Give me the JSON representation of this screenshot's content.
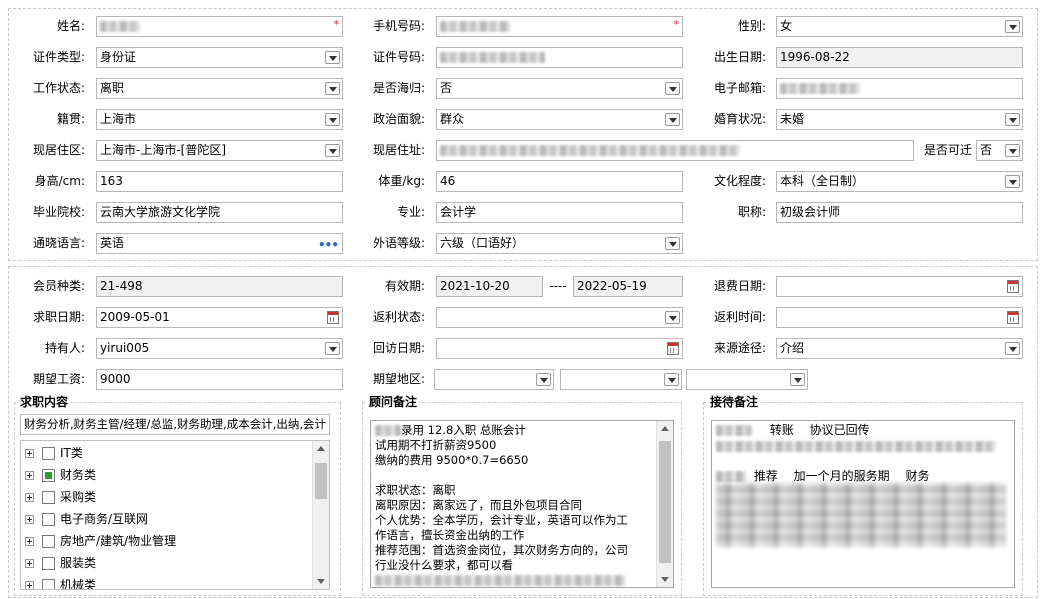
{
  "personal": {
    "name_label": "姓名:",
    "mobile_label": "手机号码:",
    "gender_label": "性别:",
    "gender_value": "女",
    "id_type_label": "证件类型:",
    "id_type_value": "身份证",
    "id_no_label": "证件号码:",
    "birth_label": "出生日期:",
    "birth_value": "1996-08-22",
    "work_status_label": "工作状态:",
    "work_status_value": "离职",
    "returnee_label": "是否海归:",
    "returnee_value": "否",
    "email_label": "电子邮箱:",
    "native_label": "籍贯:",
    "native_value": "上海市",
    "political_label": "政治面貌:",
    "political_value": "群众",
    "marital_label": "婚育状况:",
    "marital_value": "未婚",
    "district_label": "现居住区:",
    "district_value": "上海市-上海市-[普陀区]",
    "address_label": "现居住址:",
    "relocate_label": "是否可迁",
    "relocate_value": "否",
    "height_label": "身高/cm:",
    "height_value": "163",
    "weight_label": "体重/kg:",
    "weight_value": "46",
    "education_label": "文化程度:",
    "education_value": "本科（全日制）",
    "school_label": "毕业院校:",
    "school_value": "云南大学旅游文化学院",
    "major_label": "专业:",
    "major_value": "会计学",
    "title_label": "职称:",
    "title_value": "初级会计师",
    "lang_label": "通晓语言:",
    "lang_value": "英语",
    "lang_more": "•••",
    "lang_level_label": "外语等级:",
    "lang_level_value": "六级（口语好）",
    "required_mark": "*"
  },
  "member": {
    "type_label": "会员种类:",
    "type_value": "21-498",
    "valid_label": "有效期:",
    "valid_from": "2021-10-20",
    "valid_sep": "----",
    "valid_to": "2022-05-19",
    "refund_date_label": "退费日期:",
    "job_date_label": "求职日期:",
    "job_date_value": "2009-05-01",
    "rebate_status_label": "返利状态:",
    "rebate_time_label": "返利时间:",
    "holder_label": "持有人:",
    "holder_value": "yirui005",
    "visit_date_label": "回访日期:",
    "source_label": "来源途径:",
    "source_value": "介绍",
    "salary_label": "期望工资:",
    "salary_value": "9000",
    "region_label": "期望地区:"
  },
  "job_content": {
    "legend": "求职内容",
    "summary": "财务分析,财务主管/经理/总监,财务助理,成本会计,出纳,会计",
    "items": [
      {
        "label": "IT类",
        "checked": false
      },
      {
        "label": "财务类",
        "checked": true
      },
      {
        "label": "采购类",
        "checked": false
      },
      {
        "label": "电子商务/互联网",
        "checked": false
      },
      {
        "label": "房地产/建筑/物业管理",
        "checked": false
      },
      {
        "label": "服装类",
        "checked": false
      },
      {
        "label": "机械类",
        "checked": false
      }
    ]
  },
  "advisor_notes": {
    "legend": "顾问备注",
    "lines": [
      "录用 12.8入职 总账会计",
      "试用期不打折薪资9500",
      "缴纳的费用 9500*0.7=6650",
      "",
      "求职状态：离职",
      "离职原因：离家远了，而且外包项目合同",
      "个人优势：全本学历，会计专业，英语可以作为工",
      "作语言，擅长资金出纳的工作",
      "推荐范围：首选资金岗位，其次财务方向的，公司",
      "行业没什么要求，都可以看"
    ]
  },
  "reception_notes": {
    "legend": "接待备注",
    "line1_a": "转账",
    "line1_b": "协议已回传",
    "line2_a": "推荐",
    "line2_b": "加一个月的服务期",
    "line2_c": "财务"
  },
  "colors": {
    "field_border": "#b7b7b7",
    "readonly_bg": "#f1f1f1",
    "required": "#e02020",
    "checked": "#2e9e2e",
    "more_dots": "#2a6bbf"
  }
}
